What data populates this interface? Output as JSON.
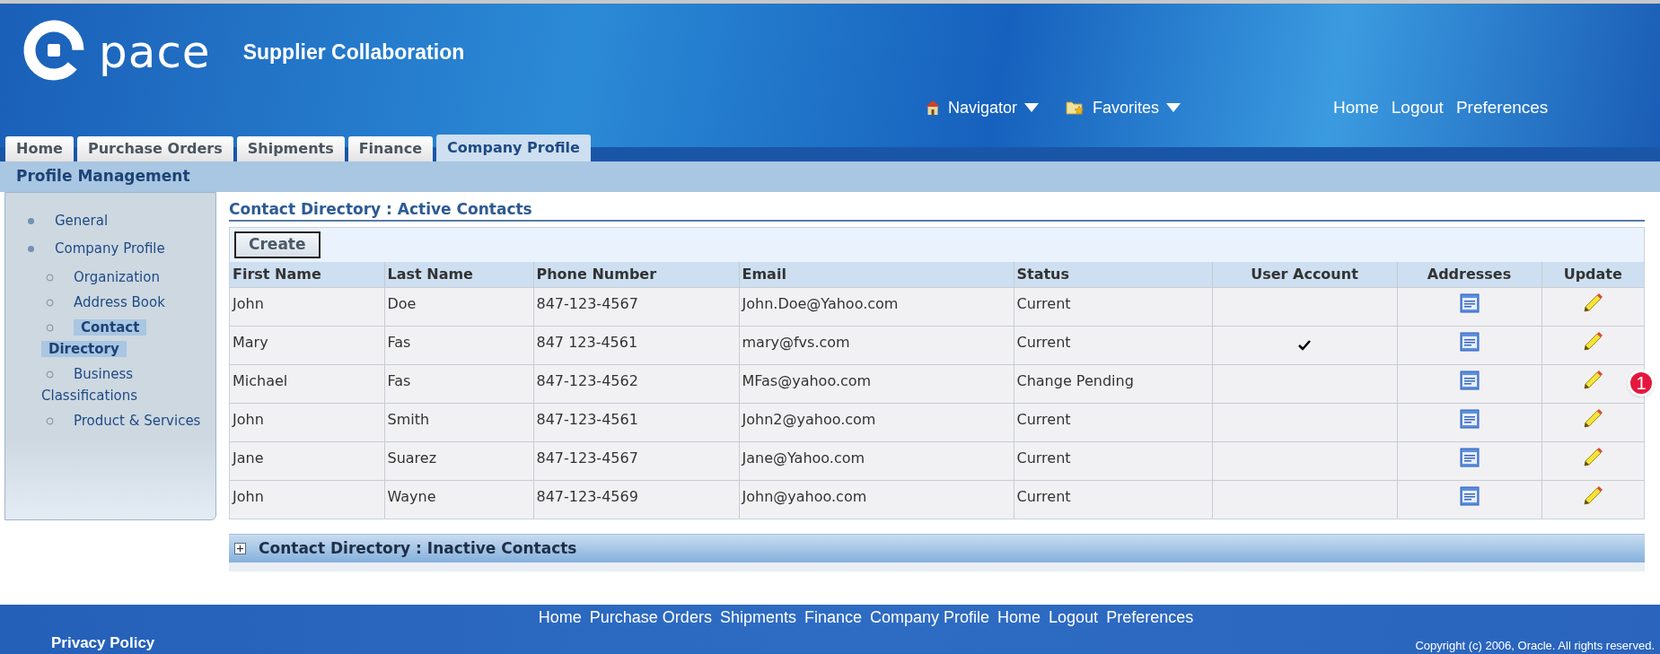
{
  "logo": {
    "text": "pace"
  },
  "app_title": "Supplier Collaboration",
  "global_menus": [
    {
      "label": "Navigator",
      "kind": "navigator"
    },
    {
      "label": "Favorites",
      "kind": "favorites"
    }
  ],
  "global_links": [
    "Home",
    "Logout",
    "Preferences"
  ],
  "tabs": [
    {
      "label": "Home",
      "selected": false
    },
    {
      "label": "Purchase Orders",
      "selected": false
    },
    {
      "label": "Shipments",
      "selected": false
    },
    {
      "label": "Finance",
      "selected": false
    },
    {
      "label": "Company Profile",
      "selected": true
    }
  ],
  "subtab_bar": {
    "title": "Profile Management"
  },
  "sidebar": {
    "items": [
      {
        "label": "General",
        "selected": false
      },
      {
        "label": "Company Profile",
        "selected": false,
        "children": [
          {
            "label": "Organization",
            "selected": false
          },
          {
            "label": "Address Book",
            "selected": false
          },
          {
            "label": "Contact Directory",
            "selected": true
          },
          {
            "label": "Business Classifications",
            "selected": false
          },
          {
            "label": "Product & Services",
            "selected": false
          }
        ]
      }
    ]
  },
  "active_section": {
    "title": "Contact Directory : Active Contacts",
    "create_button": "Create",
    "table": {
      "columns": [
        "First Name",
        "Last Name",
        "Phone Number",
        "Email",
        "Status",
        "User Account",
        "Addresses",
        "Update"
      ],
      "rows": [
        {
          "first_name": "John",
          "last_name": "Doe",
          "phone": "847-123-4567",
          "email": "John.Doe@Yahoo.com",
          "status": "Current",
          "user_account": false
        },
        {
          "first_name": "Mary",
          "last_name": "Fas",
          "phone": "847 123-4561",
          "email": "mary@fvs.com",
          "status": "Current",
          "user_account": true
        },
        {
          "first_name": "Michael",
          "last_name": "Fas",
          "phone": "847-123-4562",
          "email": "MFas@yahoo.com",
          "status": "Change Pending",
          "user_account": false,
          "callout": "1"
        },
        {
          "first_name": "John",
          "last_name": "Smith",
          "phone": "847-123-4561",
          "email": "John2@yahoo.com",
          "status": "Current",
          "user_account": false
        },
        {
          "first_name": "Jane",
          "last_name": "Suarez",
          "phone": "847-123-4567",
          "email": "Jane@Yahoo.com",
          "status": "Current",
          "user_account": false
        },
        {
          "first_name": "John",
          "last_name": "Wayne",
          "phone": "847-123-4569",
          "email": "John@yahoo.com",
          "status": "Current",
          "user_account": false
        }
      ]
    }
  },
  "inactive_section": {
    "title": "Contact Directory : Inactive Contacts",
    "expanded": false
  },
  "footer": {
    "links": [
      "Home",
      "Purchase Orders",
      "Shipments",
      "Finance",
      "Company Profile",
      "Home",
      "Logout",
      "Preferences"
    ],
    "privacy": "Privacy Policy",
    "copyright": "Copyright (c) 2006, Oracle. All rights reserved."
  }
}
